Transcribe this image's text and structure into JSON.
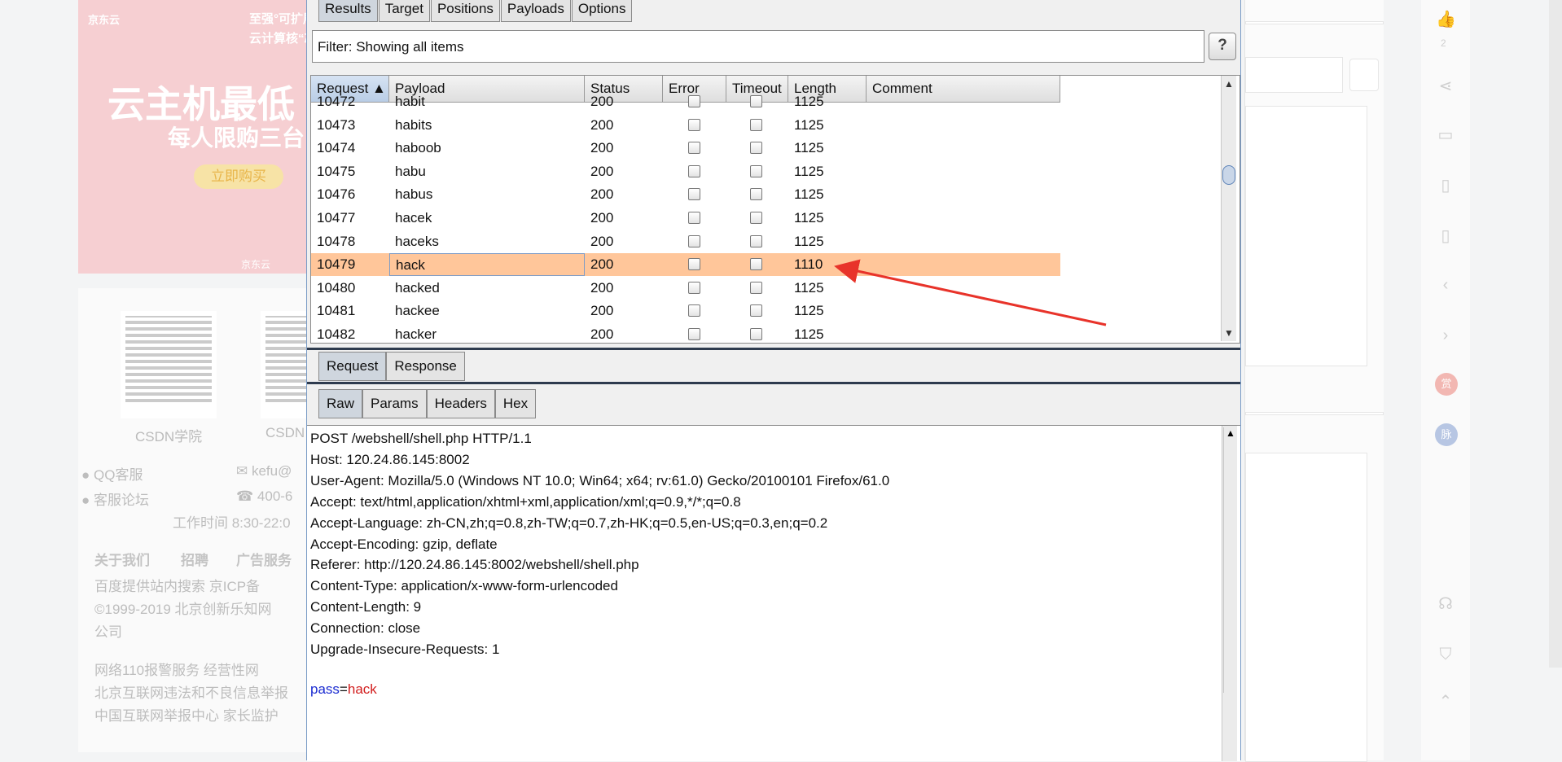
{
  "background": {
    "ad": {
      "brand_logo": "京东云",
      "line1": "至强°可扩展平台",
      "line2": "云计算核“芯”引擎",
      "headline": "云主机最低",
      "subline": "每人限购三台",
      "cta": "立即购买",
      "brand_footer": "京东云"
    },
    "qr_labels": [
      "CSDN学院",
      "CSDN"
    ],
    "contact": {
      "qq": "QQ客服",
      "email": "kefu@",
      "forum": "客服论坛",
      "phone": "400-6",
      "hours": "工作时间 8:30-22:0"
    },
    "links": [
      "关于我们",
      "招聘",
      "广告服务"
    ],
    "footer_lines": [
      "百度提供站内搜索 京ICP备",
      "©1999-2019 北京创新乐知网",
      "公司",
      "网络110报警服务  经营性网",
      "北京互联网违法和不良信息举报",
      "中国互联网举报中心  家长监护"
    ],
    "rail": {
      "like_count": "2",
      "reward": "赏",
      "mai": "脉"
    }
  },
  "burp": {
    "tabs": [
      "Results",
      "Target",
      "Positions",
      "Payloads",
      "Options"
    ],
    "active_tab": "Results",
    "filter_text": "Filter: Showing all items",
    "help_label": "?",
    "columns": [
      "Request ▲",
      "Payload",
      "Status",
      "Error",
      "Timeout",
      "Length",
      "Comment"
    ],
    "rows": [
      {
        "request": "10472",
        "payload": "habit",
        "status": "200",
        "length": "1125"
      },
      {
        "request": "10473",
        "payload": "habits",
        "status": "200",
        "length": "1125"
      },
      {
        "request": "10474",
        "payload": "haboob",
        "status": "200",
        "length": "1125"
      },
      {
        "request": "10475",
        "payload": "habu",
        "status": "200",
        "length": "1125"
      },
      {
        "request": "10476",
        "payload": "habus",
        "status": "200",
        "length": "1125"
      },
      {
        "request": "10477",
        "payload": "hacek",
        "status": "200",
        "length": "1125"
      },
      {
        "request": "10478",
        "payload": "haceks",
        "status": "200",
        "length": "1125"
      },
      {
        "request": "10479",
        "payload": "hack",
        "status": "200",
        "length": "1110"
      },
      {
        "request": "10480",
        "payload": "hacked",
        "status": "200",
        "length": "1125"
      },
      {
        "request": "10481",
        "payload": "hackee",
        "status": "200",
        "length": "1125"
      },
      {
        "request": "10482",
        "payload": "hacker",
        "status": "200",
        "length": "1125"
      }
    ],
    "selected_request": "10479",
    "message_tabs": [
      "Request",
      "Response"
    ],
    "view_tabs": [
      "Raw",
      "Params",
      "Headers",
      "Hex"
    ],
    "request_lines": [
      "POST /webshell/shell.php HTTP/1.1",
      "Host: 120.24.86.145:8002",
      "User-Agent: Mozilla/5.0 (Windows NT 10.0; Win64; x64; rv:61.0) Gecko/20100101 Firefox/61.0",
      "Accept: text/html,application/xhtml+xml,application/xml;q=0.9,*/*;q=0.8",
      "Accept-Language: zh-CN,zh;q=0.8,zh-TW;q=0.7,zh-HK;q=0.5,en-US;q=0.3,en;q=0.2",
      "Accept-Encoding: gzip, deflate",
      "Referer: http://120.24.86.145:8002/webshell/shell.php",
      "Content-Type: application/x-www-form-urlencoded",
      "Content-Length: 9",
      "Connection: close",
      "Upgrade-Insecure-Requests: 1"
    ],
    "body_param": {
      "key": "pass",
      "sep": "=",
      "value": "hack"
    }
  },
  "colors": {
    "selected_row": "#ffc69a",
    "annotation_arrow": "#e8332a",
    "param_key": "#1a2bd1",
    "param_value": "#d21e1e"
  }
}
